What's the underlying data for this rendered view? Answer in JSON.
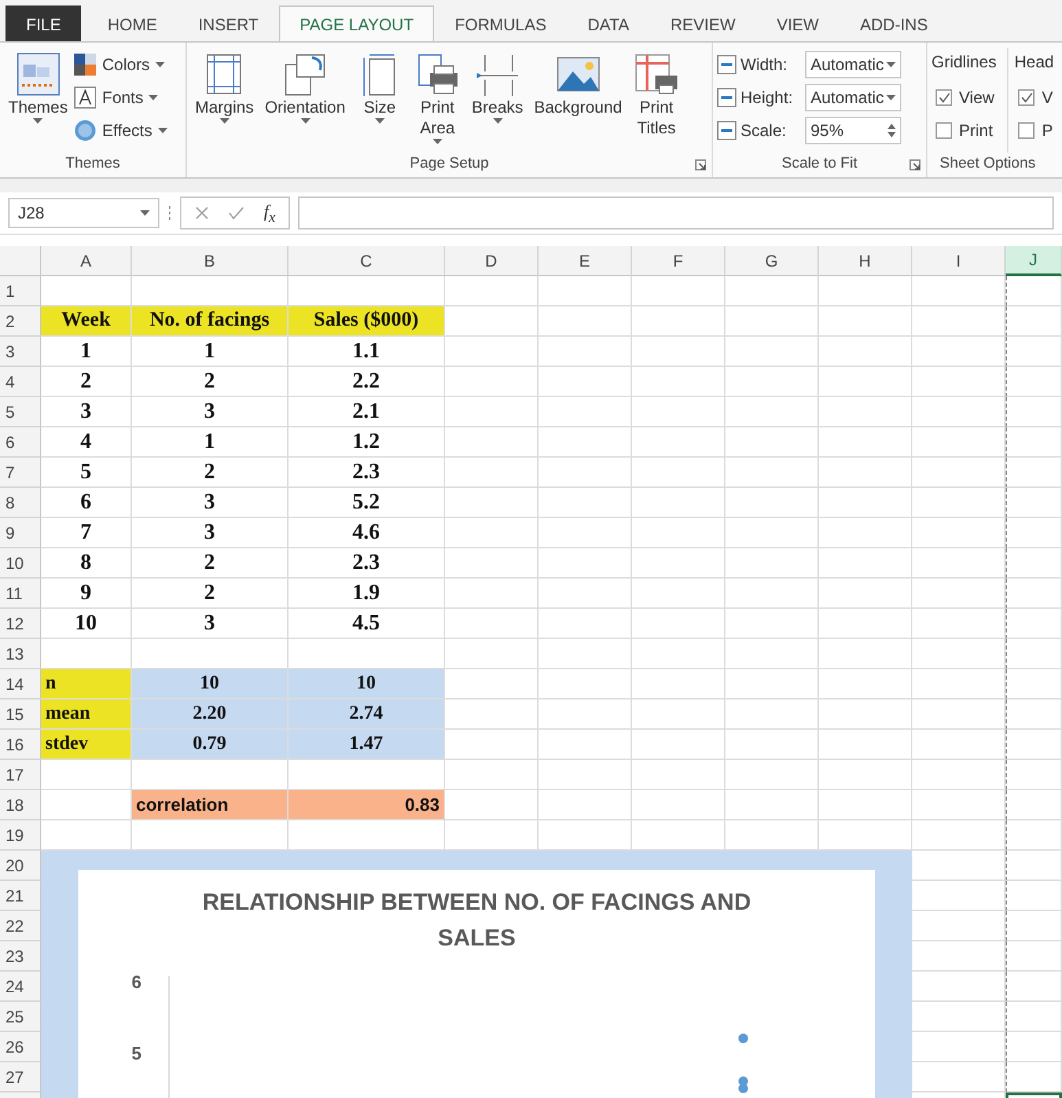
{
  "ribbon_tabs": [
    {
      "label": "FILE",
      "kind": "file",
      "selected": false
    },
    {
      "label": "HOME",
      "kind": "tab",
      "selected": false
    },
    {
      "label": "INSERT",
      "kind": "tab",
      "selected": false
    },
    {
      "label": "PAGE LAYOUT",
      "kind": "tab",
      "selected": true
    },
    {
      "label": "FORMULAS",
      "kind": "tab",
      "selected": false
    },
    {
      "label": "DATA",
      "kind": "tab",
      "selected": false
    },
    {
      "label": "REVIEW",
      "kind": "tab",
      "selected": false
    },
    {
      "label": "VIEW",
      "kind": "tab",
      "selected": false
    },
    {
      "label": "ADD-INS",
      "kind": "tab",
      "selected": false
    }
  ],
  "themes_group": {
    "label": "Themes",
    "big_button": {
      "label": "Themes",
      "kind": "themes"
    },
    "small_buttons": [
      {
        "label": "Colors",
        "kind": "colors"
      },
      {
        "label": "Fonts",
        "kind": "fonts"
      },
      {
        "label": "Effects",
        "kind": "effects"
      }
    ]
  },
  "page_setup_group": {
    "label": "Page Setup",
    "launcher": true,
    "buttons": [
      {
        "label": "Margins",
        "kind": "margins",
        "dropdown": true
      },
      {
        "label": "Orientation",
        "kind": "orientation",
        "dropdown": true
      },
      {
        "label": "Size",
        "kind": "size",
        "dropdown": true
      },
      {
        "label": "Print Area",
        "kind": "print_area",
        "dropdown": true
      },
      {
        "label": "Breaks",
        "kind": "breaks",
        "dropdown": true
      },
      {
        "label": "Background",
        "kind": "background",
        "dropdown": false
      },
      {
        "label": "Print Titles",
        "kind": "print_titles",
        "dropdown": false
      }
    ]
  },
  "scale_group": {
    "label": "Scale to Fit",
    "launcher": true,
    "rows": [
      {
        "label": "Width:",
        "value": "Automatic",
        "kind": "dropdown"
      },
      {
        "label": "Height:",
        "value": "Automatic",
        "kind": "dropdown"
      },
      {
        "label": "Scale:",
        "value": "95%",
        "kind": "spinner"
      }
    ]
  },
  "sheet_options": {
    "label": "Sheet Options",
    "columns": [
      {
        "heading": "Gridlines",
        "options": [
          {
            "label": "View",
            "checked": true
          },
          {
            "label": "Print",
            "checked": false
          }
        ]
      },
      {
        "heading": "Head",
        "options": [
          {
            "label": "V",
            "checked": true
          },
          {
            "label": "P",
            "checked": false
          }
        ]
      }
    ]
  },
  "formula_bar": {
    "name_box": "J28",
    "function_symbol": "f$_{x}$"
  },
  "sheet": {
    "columns": [
      {
        "label": "A",
        "selected": false
      },
      {
        "label": "B",
        "selected": false
      },
      {
        "label": "C",
        "selected": false
      },
      {
        "label": "D",
        "selected": false
      },
      {
        "label": "E",
        "selected": false
      },
      {
        "label": "F",
        "selected": false
      },
      {
        "label": "G",
        "selected": false
      },
      {
        "label": "H",
        "selected": false
      },
      {
        "label": "I",
        "selected": false
      },
      {
        "label": "J",
        "selected": true
      }
    ],
    "rows": [
      {
        "number": "1"
      },
      {
        "number": "2",
        "cells": [
          {
            "text": "Week",
            "kind": "header"
          },
          {
            "text": "No. of facings",
            "kind": "header"
          },
          {
            "text": "Sales ($000)",
            "kind": "header"
          }
        ]
      },
      {
        "number": "3",
        "cells": [
          {
            "text": "1",
            "kind": "data"
          },
          {
            "text": "1",
            "kind": "data"
          },
          {
            "text": "1.1",
            "kind": "data"
          }
        ]
      },
      {
        "number": "4",
        "cells": [
          {
            "text": "2",
            "kind": "data"
          },
          {
            "text": "2",
            "kind": "data"
          },
          {
            "text": "2.2",
            "kind": "data"
          }
        ]
      },
      {
        "number": "5",
        "cells": [
          {
            "text": "3",
            "kind": "data"
          },
          {
            "text": "3",
            "kind": "data"
          },
          {
            "text": "2.1",
            "kind": "data"
          }
        ]
      },
      {
        "number": "6",
        "cells": [
          {
            "text": "4",
            "kind": "data"
          },
          {
            "text": "1",
            "kind": "data"
          },
          {
            "text": "1.2",
            "kind": "data"
          }
        ]
      },
      {
        "number": "7",
        "cells": [
          {
            "text": "5",
            "kind": "data"
          },
          {
            "text": "2",
            "kind": "data"
          },
          {
            "text": "2.3",
            "kind": "data"
          }
        ]
      },
      {
        "number": "8",
        "cells": [
          {
            "text": "6",
            "kind": "data"
          },
          {
            "text": "3",
            "kind": "data"
          },
          {
            "text": "5.2",
            "kind": "data"
          }
        ]
      },
      {
        "number": "9",
        "cells": [
          {
            "text": "7",
            "kind": "data"
          },
          {
            "text": "3",
            "kind": "data"
          },
          {
            "text": "4.6",
            "kind": "data"
          }
        ]
      },
      {
        "number": "10",
        "cells": [
          {
            "text": "8",
            "kind": "data"
          },
          {
            "text": "2",
            "kind": "data"
          },
          {
            "text": "2.3",
            "kind": "data"
          }
        ]
      },
      {
        "number": "11",
        "cells": [
          {
            "text": "9",
            "kind": "data"
          },
          {
            "text": "2",
            "kind": "data"
          },
          {
            "text": "1.9",
            "kind": "data"
          }
        ]
      },
      {
        "number": "12",
        "cells": [
          {
            "text": "10",
            "kind": "data"
          },
          {
            "text": "3",
            "kind": "data"
          },
          {
            "text": "4.5",
            "kind": "data"
          }
        ]
      },
      {
        "number": "13"
      },
      {
        "number": "14",
        "cells": [
          {
            "text": "n",
            "kind": "stat_label"
          },
          {
            "text": "10",
            "kind": "stat"
          },
          {
            "text": "10",
            "kind": "stat"
          }
        ]
      },
      {
        "number": "15",
        "cells": [
          {
            "text": "mean",
            "kind": "stat_label"
          },
          {
            "text": "2.20",
            "kind": "stat"
          },
          {
            "text": "2.74",
            "kind": "stat"
          }
        ]
      },
      {
        "number": "16",
        "cells": [
          {
            "text": "stdev",
            "kind": "stat_label"
          },
          {
            "text": "0.79",
            "kind": "stat"
          },
          {
            "text": "1.47",
            "kind": "stat"
          }
        ]
      },
      {
        "number": "17"
      },
      {
        "number": "18",
        "cells": [
          null,
          {
            "text": "correlation",
            "kind": "corr_label"
          },
          {
            "text": "0.83",
            "kind": "corr_value"
          }
        ]
      },
      {
        "number": "19"
      },
      {
        "number": "20"
      },
      {
        "number": "21"
      },
      {
        "number": "22"
      },
      {
        "number": "23"
      },
      {
        "number": "24"
      },
      {
        "number": "25"
      },
      {
        "number": "26"
      },
      {
        "number": "27"
      }
    ]
  },
  "chart": {
    "title": "RELATIONSHIP BETWEEN NO. OF FACINGS AND SALES",
    "y_tick_labels": [
      "6",
      "5"
    ]
  }
}
